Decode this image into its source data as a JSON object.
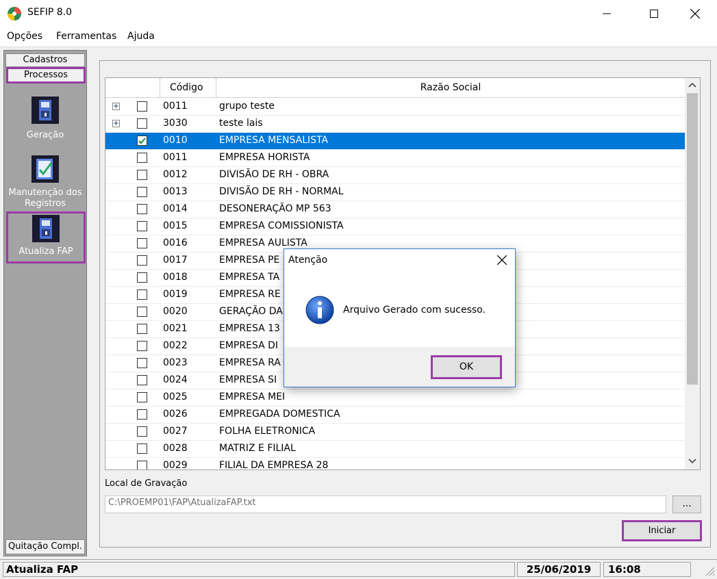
{
  "window": {
    "title": "SEFIP 8.0"
  },
  "menu": [
    "Opções",
    "Ferramentas",
    "Ajuda"
  ],
  "sidebar": {
    "tabs": [
      "Cadastros",
      "Processos"
    ],
    "items": [
      {
        "label": "Geração",
        "icon": "disk-icon"
      },
      {
        "label": "Manutenção dos Registros",
        "icon": "checklist-icon"
      },
      {
        "label": "Atualiza FAP",
        "icon": "disk-icon"
      }
    ],
    "bottom_tab": "Quitação Compl."
  },
  "grid": {
    "columns": [
      "Código",
      "Razão Social"
    ],
    "rows": [
      {
        "code": "0011",
        "name": "grupo teste",
        "expand": "+",
        "checked": false
      },
      {
        "code": "3030",
        "name": "teste lais",
        "expand": "+",
        "checked": false
      },
      {
        "code": "0010",
        "name": "EMPRESA MENSALISTA",
        "checked": true,
        "selected": true
      },
      {
        "code": "0011",
        "name": "EMPRESA HORISTA",
        "checked": false
      },
      {
        "code": "0012",
        "name": "DIVISÃO DE RH - OBRA",
        "checked": false
      },
      {
        "code": "0013",
        "name": "DIVISÃO DE RH - NORMAL",
        "checked": false
      },
      {
        "code": "0014",
        "name": "DESONERAÇÃO MP 563",
        "checked": false
      },
      {
        "code": "0015",
        "name": "EMPRESA COMISSIONISTA",
        "checked": false
      },
      {
        "code": "0016",
        "name": "EMPRESA AULISTA",
        "checked": false
      },
      {
        "code": "0017",
        "name": "EMPRESA PE",
        "checked": false
      },
      {
        "code": "0018",
        "name": "EMPRESA TA",
        "checked": false
      },
      {
        "code": "0019",
        "name": "EMPRESA RE",
        "checked": false
      },
      {
        "code": "0020",
        "name": "GERAÇÃO DA",
        "checked": false
      },
      {
        "code": "0021",
        "name": "EMPRESA 13",
        "checked": false
      },
      {
        "code": "0022",
        "name": "EMPRESA DI",
        "checked": false
      },
      {
        "code": "0023",
        "name": "EMPRESA RA",
        "checked": false
      },
      {
        "code": "0024",
        "name": "EMPRESA SI",
        "checked": false
      },
      {
        "code": "0025",
        "name": "EMPRESA MEI",
        "checked": false
      },
      {
        "code": "0026",
        "name": "EMPREGADA DOMESTICA",
        "checked": false
      },
      {
        "code": "0027",
        "name": "FOLHA ELETRONICA",
        "checked": false
      },
      {
        "code": "0028",
        "name": "MATRIZ E FILIAL",
        "checked": false
      },
      {
        "code": "0029",
        "name": "FILIAL DA EMPRESA 28",
        "checked": false
      }
    ]
  },
  "local": {
    "label": "Local de Gravação",
    "path": "C:\\PROEMP01\\FAP\\AtualizaFAP.txt",
    "browse": "..."
  },
  "iniciar": "Iniciar",
  "status": {
    "module": "Atualiza FAP",
    "date": "25/06/2019",
    "time": "16:08"
  },
  "dialog": {
    "title": "Atenção",
    "message": "Arquivo Gerado com sucesso.",
    "ok": "OK"
  },
  "colors": {
    "selection": "#0078d7",
    "highlight": "#9b3ca6",
    "sidebar": "#a3a3a3"
  }
}
